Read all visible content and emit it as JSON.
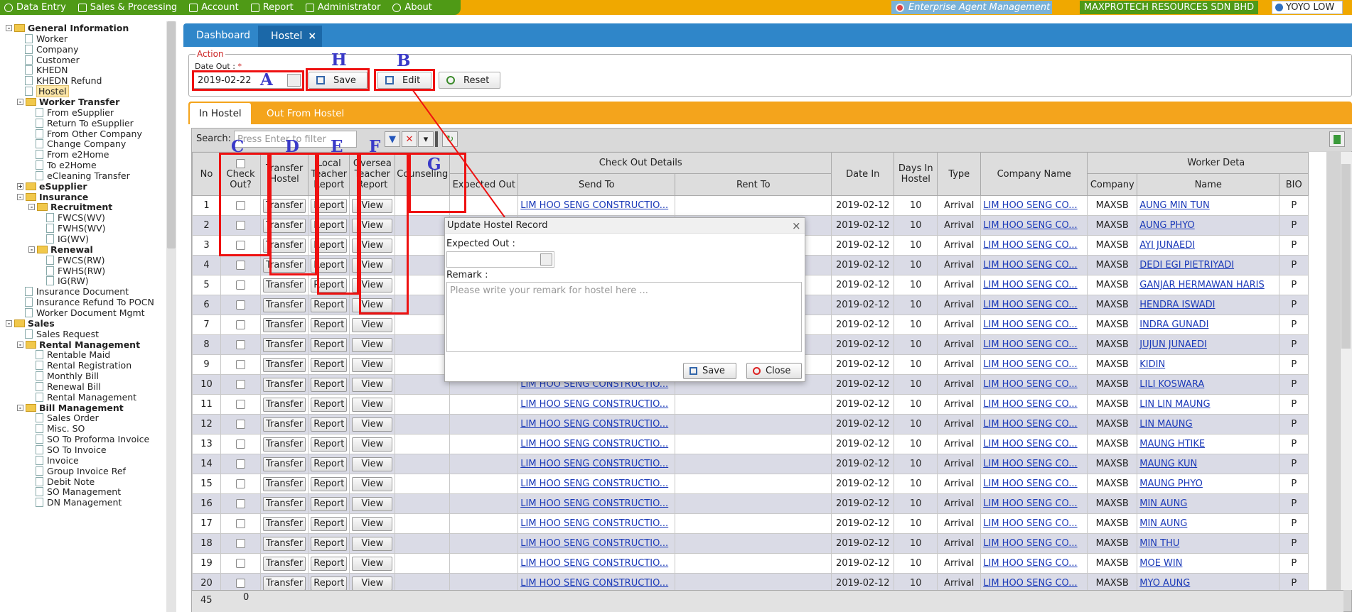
{
  "menu": {
    "items": [
      {
        "label": "Data Entry",
        "icon": "info-icon"
      },
      {
        "label": "Sales & Processing",
        "icon": "cart-icon"
      },
      {
        "label": "Account",
        "icon": "briefcase-icon"
      },
      {
        "label": "Report",
        "icon": "table-icon"
      },
      {
        "label": "Administrator",
        "icon": "users-icon"
      },
      {
        "label": "About",
        "icon": "help-icon"
      }
    ]
  },
  "header": {
    "agent": "Enterprise Agent Management",
    "company": "MAXPROTECH RESOURCES SDN BHD",
    "user": "YOYO LOW"
  },
  "sidebar": {
    "items": [
      {
        "label": "General Information",
        "type": "folder",
        "depth": 0,
        "exp": "-"
      },
      {
        "label": "Worker",
        "type": "doc",
        "depth": 1
      },
      {
        "label": "Company",
        "type": "doc",
        "depth": 1
      },
      {
        "label": "Customer",
        "type": "doc",
        "depth": 1
      },
      {
        "label": "KHEDN",
        "type": "doc",
        "depth": 1
      },
      {
        "label": "KHEDN Refund",
        "type": "doc",
        "depth": 1
      },
      {
        "label": "Hostel",
        "type": "doc",
        "depth": 1,
        "selected": true
      },
      {
        "label": "Worker Transfer",
        "type": "folder",
        "depth": 1,
        "exp": "-"
      },
      {
        "label": "From eSupplier",
        "type": "doc",
        "depth": 2
      },
      {
        "label": "Return To eSupplier",
        "type": "doc",
        "depth": 2
      },
      {
        "label": "From Other Company",
        "type": "doc",
        "depth": 2
      },
      {
        "label": "Change Company",
        "type": "doc",
        "depth": 2
      },
      {
        "label": "From e2Home",
        "type": "doc",
        "depth": 2
      },
      {
        "label": "To e2Home",
        "type": "doc",
        "depth": 2
      },
      {
        "label": "eCleaning Transfer",
        "type": "doc",
        "depth": 2
      },
      {
        "label": "eSupplier",
        "type": "folder",
        "depth": 1,
        "exp": "+"
      },
      {
        "label": "Insurance",
        "type": "folder",
        "depth": 1,
        "exp": "-"
      },
      {
        "label": "Recruitment",
        "type": "folder",
        "depth": 2,
        "exp": "-"
      },
      {
        "label": "FWCS(WV)",
        "type": "doc",
        "depth": 3
      },
      {
        "label": "FWHS(WV)",
        "type": "doc",
        "depth": 3
      },
      {
        "label": "IG(WV)",
        "type": "doc",
        "depth": 3
      },
      {
        "label": "Renewal",
        "type": "folder",
        "depth": 2,
        "exp": "-"
      },
      {
        "label": "FWCS(RW)",
        "type": "doc",
        "depth": 3
      },
      {
        "label": "FWHS(RW)",
        "type": "doc",
        "depth": 3
      },
      {
        "label": "IG(RW)",
        "type": "doc",
        "depth": 3
      },
      {
        "label": "Insurance Document",
        "type": "doc",
        "depth": 1
      },
      {
        "label": "Insurance Refund To POCN",
        "type": "doc",
        "depth": 1
      },
      {
        "label": "Worker Document Mgmt",
        "type": "doc",
        "depth": 1
      },
      {
        "label": "Sales",
        "type": "folder",
        "depth": 0,
        "exp": "-"
      },
      {
        "label": "Sales Request",
        "type": "doc",
        "depth": 1
      },
      {
        "label": "Rental Management",
        "type": "folder",
        "depth": 1,
        "exp": "-"
      },
      {
        "label": "Rentable Maid",
        "type": "doc",
        "depth": 2
      },
      {
        "label": "Rental Registration",
        "type": "doc",
        "depth": 2
      },
      {
        "label": "Monthly Bill",
        "type": "doc",
        "depth": 2
      },
      {
        "label": "Renewal Bill",
        "type": "doc",
        "depth": 2
      },
      {
        "label": "Rental Management",
        "type": "doc",
        "depth": 2
      },
      {
        "label": "Bill Management",
        "type": "folder",
        "depth": 1,
        "exp": "-"
      },
      {
        "label": "Sales Order",
        "type": "doc",
        "depth": 2
      },
      {
        "label": "Misc. SO",
        "type": "doc",
        "depth": 2
      },
      {
        "label": "SO To Proforma Invoice",
        "type": "doc",
        "depth": 2
      },
      {
        "label": "SO To Invoice",
        "type": "doc",
        "depth": 2
      },
      {
        "label": "Invoice",
        "type": "doc",
        "depth": 2
      },
      {
        "label": "Group Invoice Ref",
        "type": "doc",
        "depth": 2
      },
      {
        "label": "Debit Note",
        "type": "doc",
        "depth": 2
      },
      {
        "label": "SO Management",
        "type": "doc",
        "depth": 2
      },
      {
        "label": "DN Management",
        "type": "doc",
        "depth": 2
      }
    ]
  },
  "tabs": {
    "dashboard": "Dashboard",
    "hostel": "Hostel",
    "close": "×"
  },
  "action": {
    "legend": "Action",
    "date_out_label": "Date Out :",
    "required": "*",
    "date_out": "2019-02-22",
    "save": "Save",
    "edit": "Edit",
    "reset": "Reset"
  },
  "annotations": {
    "A": "A",
    "B": "B",
    "C": "C",
    "D": "D",
    "E": "E",
    "F": "F",
    "G": "G",
    "H": "H"
  },
  "subtabs": {
    "in": "In Hostel",
    "out": "Out From Hostel"
  },
  "grid": {
    "search_label": "Search:",
    "search_placeholder": "Press Enter to filter",
    "headers": {
      "no": "No",
      "checkout": "Check Out?",
      "transfer": "Transfer Hostel",
      "local": "Local Teacher Report",
      "oversea": "Oversea Teacher Report",
      "counseling": "Counseling",
      "checkout_details": "Check Out Details",
      "expected_out": "Expected Out",
      "send_to": "Send To",
      "rent_to": "Rent To",
      "date_in": "Date In",
      "days": "Days In Hostel",
      "type": "Type",
      "company_name": "Company Name",
      "worker_details": "Worker Deta",
      "company": "Company",
      "name": "Name",
      "bio": "BIO"
    },
    "btn": {
      "transfer": "Transfer",
      "report": "Report",
      "view": "View"
    },
    "rows": [
      {
        "no": "1",
        "send_to": "LIM HOO SENG CONSTRUCTIO...",
        "date_in": "2019-02-12",
        "days": "10",
        "type": "Arrival",
        "company_name": "LIM HOO SENG CO...",
        "company": "MAXSB",
        "name": "AUNG MIN TUN",
        "bio": "P"
      },
      {
        "no": "2",
        "send_to": "",
        "date_in": "2019-02-12",
        "days": "10",
        "type": "Arrival",
        "company_name": "LIM HOO SENG CO...",
        "company": "MAXSB",
        "name": "AUNG PHYO",
        "bio": "P"
      },
      {
        "no": "3",
        "send_to": "",
        "date_in": "2019-02-12",
        "days": "10",
        "type": "Arrival",
        "company_name": "LIM HOO SENG CO...",
        "company": "MAXSB",
        "name": "AYI JUNAEDI",
        "bio": "P"
      },
      {
        "no": "4",
        "send_to": "",
        "date_in": "2019-02-12",
        "days": "10",
        "type": "Arrival",
        "company_name": "LIM HOO SENG CO...",
        "company": "MAXSB",
        "name": "DEDI EGI PIETRIYADI",
        "bio": "P"
      },
      {
        "no": "5",
        "send_to": "",
        "date_in": "2019-02-12",
        "days": "10",
        "type": "Arrival",
        "company_name": "LIM HOO SENG CO...",
        "company": "MAXSB",
        "name": "GANJAR HERMAWAN HARIS",
        "bio": "P"
      },
      {
        "no": "6",
        "send_to": "",
        "date_in": "2019-02-12",
        "days": "10",
        "type": "Arrival",
        "company_name": "LIM HOO SENG CO...",
        "company": "MAXSB",
        "name": "HENDRA ISWADI",
        "bio": "P"
      },
      {
        "no": "7",
        "send_to": "",
        "date_in": "2019-02-12",
        "days": "10",
        "type": "Arrival",
        "company_name": "LIM HOO SENG CO...",
        "company": "MAXSB",
        "name": "INDRA GUNADI",
        "bio": "P"
      },
      {
        "no": "8",
        "send_to": "",
        "date_in": "2019-02-12",
        "days": "10",
        "type": "Arrival",
        "company_name": "LIM HOO SENG CO...",
        "company": "MAXSB",
        "name": "JUJUN JUNAEDI",
        "bio": "P"
      },
      {
        "no": "9",
        "send_to": "",
        "date_in": "2019-02-12",
        "days": "10",
        "type": "Arrival",
        "company_name": "LIM HOO SENG CO...",
        "company": "MAXSB",
        "name": "KIDIN",
        "bio": "P"
      },
      {
        "no": "10",
        "send_to": "LIM HOO SENG CONSTRUCTIO...",
        "date_in": "2019-02-12",
        "days": "10",
        "type": "Arrival",
        "company_name": "LIM HOO SENG CO...",
        "company": "MAXSB",
        "name": "LILI KOSWARA",
        "bio": "P"
      },
      {
        "no": "11",
        "send_to": "LIM HOO SENG CONSTRUCTIO...",
        "date_in": "2019-02-12",
        "days": "10",
        "type": "Arrival",
        "company_name": "LIM HOO SENG CO...",
        "company": "MAXSB",
        "name": "LIN LIN MAUNG",
        "bio": "P"
      },
      {
        "no": "12",
        "send_to": "LIM HOO SENG CONSTRUCTIO...",
        "date_in": "2019-02-12",
        "days": "10",
        "type": "Arrival",
        "company_name": "LIM HOO SENG CO...",
        "company": "MAXSB",
        "name": "LIN MAUNG",
        "bio": "P"
      },
      {
        "no": "13",
        "send_to": "LIM HOO SENG CONSTRUCTIO...",
        "date_in": "2019-02-12",
        "days": "10",
        "type": "Arrival",
        "company_name": "LIM HOO SENG CO...",
        "company": "MAXSB",
        "name": "MAUNG HTIKE",
        "bio": "P"
      },
      {
        "no": "14",
        "send_to": "LIM HOO SENG CONSTRUCTIO...",
        "date_in": "2019-02-12",
        "days": "10",
        "type": "Arrival",
        "company_name": "LIM HOO SENG CO...",
        "company": "MAXSB",
        "name": "MAUNG KUN",
        "bio": "P"
      },
      {
        "no": "15",
        "send_to": "LIM HOO SENG CONSTRUCTIO...",
        "date_in": "2019-02-12",
        "days": "10",
        "type": "Arrival",
        "company_name": "LIM HOO SENG CO...",
        "company": "MAXSB",
        "name": "MAUNG PHYO",
        "bio": "P"
      },
      {
        "no": "16",
        "send_to": "LIM HOO SENG CONSTRUCTIO...",
        "date_in": "2019-02-12",
        "days": "10",
        "type": "Arrival",
        "company_name": "LIM HOO SENG CO...",
        "company": "MAXSB",
        "name": "MIN AUNG",
        "bio": "P"
      },
      {
        "no": "17",
        "send_to": "LIM HOO SENG CONSTRUCTIO...",
        "date_in": "2019-02-12",
        "days": "10",
        "type": "Arrival",
        "company_name": "LIM HOO SENG CO...",
        "company": "MAXSB",
        "name": "MIN AUNG",
        "bio": "P"
      },
      {
        "no": "18",
        "send_to": "LIM HOO SENG CONSTRUCTIO...",
        "date_in": "2019-02-12",
        "days": "10",
        "type": "Arrival",
        "company_name": "LIM HOO SENG CO...",
        "company": "MAXSB",
        "name": "MIN THU",
        "bio": "P"
      },
      {
        "no": "19",
        "send_to": "LIM HOO SENG CONSTRUCTIO...",
        "date_in": "2019-02-12",
        "days": "10",
        "type": "Arrival",
        "company_name": "LIM HOO SENG CO...",
        "company": "MAXSB",
        "name": "MOE WIN",
        "bio": "P"
      },
      {
        "no": "20",
        "send_to": "LIM HOO SENG CONSTRUCTIO...",
        "date_in": "2019-02-12",
        "days": "10",
        "type": "Arrival",
        "company_name": "LIM HOO SENG CO...",
        "company": "MAXSB",
        "name": "MYO AUNG",
        "bio": "P"
      }
    ],
    "footer": {
      "count": "45",
      "checked": "0"
    }
  },
  "modal": {
    "title": "Update Hostel Record",
    "close": "×",
    "expected_out_label": "Expected Out :",
    "remark_label": "Remark :",
    "remark_placeholder": "Please write your remark for hostel here ...",
    "save": "Save",
    "close_btn": "Close"
  }
}
